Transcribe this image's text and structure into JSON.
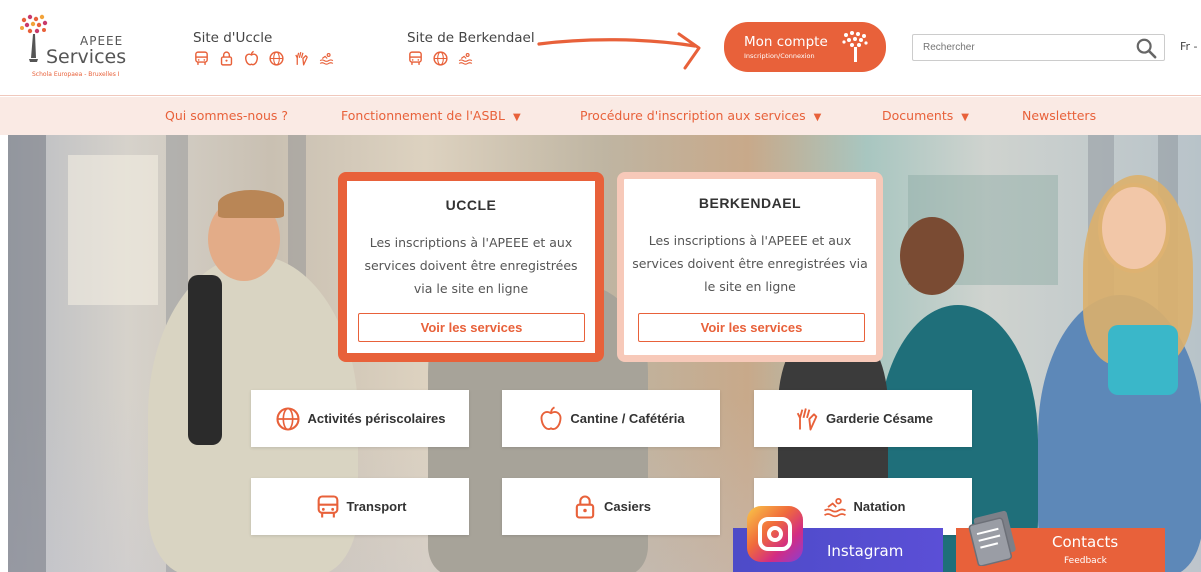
{
  "brand": {
    "top": "APEEE",
    "main": "Services",
    "sub": "Schola Europaea - Bruxelles I"
  },
  "sites": [
    {
      "title": "Site d'Uccle",
      "icons": [
        "bus-icon",
        "locker-icon",
        "apple-icon",
        "globe-icon",
        "hand-icon",
        "swimming-icon"
      ]
    },
    {
      "title": "Site de Berkendael",
      "icons": [
        "bus-icon",
        "globe-icon",
        "swimming-icon"
      ]
    }
  ],
  "account": {
    "title": "Mon compte",
    "subtitle": "Inscription/Connexion"
  },
  "search": {
    "placeholder": "Rechercher"
  },
  "language": "Fr -",
  "nav": [
    {
      "label": "Qui sommes-nous ?",
      "has_caret": false
    },
    {
      "label": "Fonctionnement de l'ASBL",
      "has_caret": true
    },
    {
      "label": "Procédure d'inscription aux services",
      "has_caret": true
    },
    {
      "label": "Documents",
      "has_caret": true
    },
    {
      "label": "Newsletters",
      "has_caret": false
    }
  ],
  "nav_caret": "▼",
  "cards": [
    {
      "title": "UCCLE",
      "text": "Les inscriptions à l'APEEE et aux services doivent être enregistrées via le site en ligne",
      "button": "Voir les services"
    },
    {
      "title": "BERKENDAEL",
      "text": "Les inscriptions à l'APEEE et aux services doivent être enregistrées via le site en ligne",
      "button": "Voir les services"
    }
  ],
  "services": [
    {
      "label": "Activités périscolaires",
      "icon": "globe-icon"
    },
    {
      "label": "Cantine / Cafétéria",
      "icon": "apple-icon"
    },
    {
      "label": "Garderie Césame",
      "icon": "hand-icon"
    },
    {
      "label": "Transport",
      "icon": "bus-icon"
    },
    {
      "label": "Casiers",
      "icon": "locker-icon"
    },
    {
      "label": "Natation",
      "icon": "swimming-icon"
    }
  ],
  "social": {
    "instagram": "Instagram",
    "contacts_title": "Contacts",
    "contacts_sub": "Feedback"
  },
  "colors": {
    "accent": "#e8613a",
    "accent_light": "#f7c9b9",
    "nav_bg": "#faeae4",
    "instagram": "#5b4fd6"
  }
}
